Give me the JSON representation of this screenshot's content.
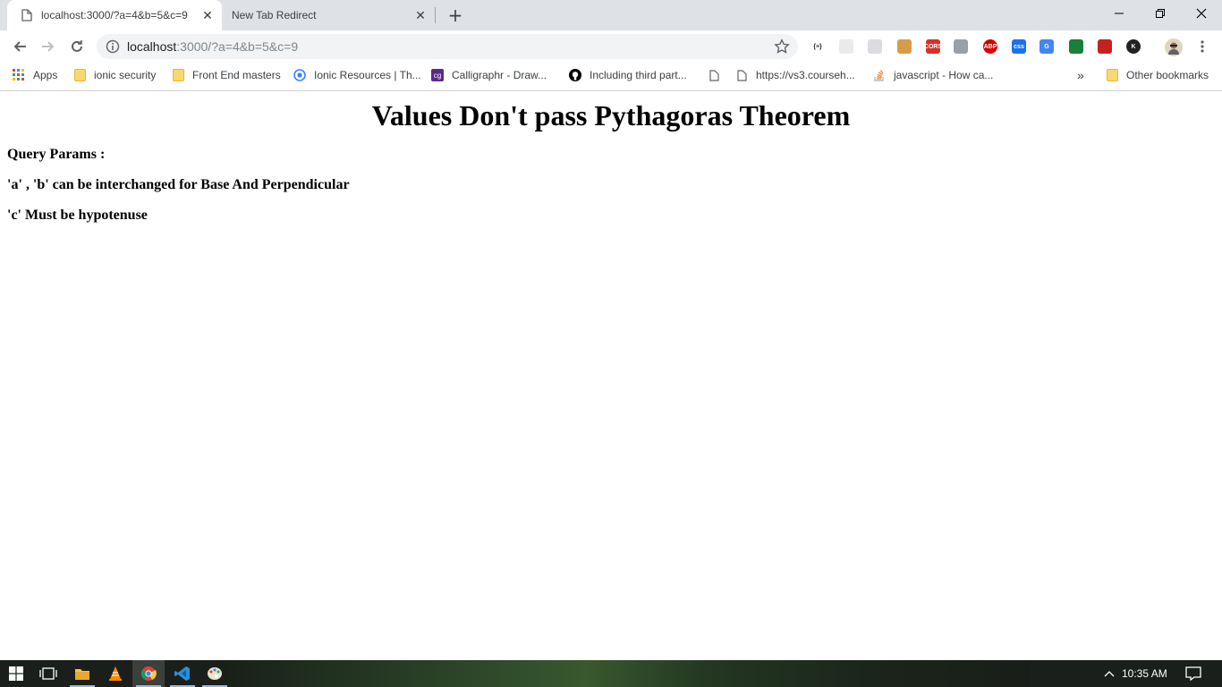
{
  "browser": {
    "tabs": [
      {
        "title": "localhost:3000/?a=4&b=5&c=9",
        "active": true
      },
      {
        "title": "New Tab Redirect",
        "active": false
      }
    ],
    "address": {
      "host": "localhost",
      "rest": ":3000/?a=4&b=5&c=9"
    },
    "bookmarks": [
      {
        "label": "Apps",
        "icon": "apps-grid-icon"
      },
      {
        "label": "ionic security",
        "icon": "folder-icon"
      },
      {
        "label": "Front End masters",
        "icon": "folder-icon"
      },
      {
        "label": "Ionic Resources | Th...",
        "icon": "ionic-icon"
      },
      {
        "label": "Calligraphr - Draw...",
        "icon": "calligraphr-icon"
      },
      {
        "label": "Including third part...",
        "icon": "github-icon"
      },
      {
        "label": "",
        "icon": "page-icon"
      },
      {
        "label": "https://vs3.courseh...",
        "icon": "page-icon"
      },
      {
        "label": "javascript - How ca...",
        "icon": "stackoverflow-icon"
      }
    ],
    "bookmarks_overflow": "»",
    "other_bookmarks": "Other bookmarks"
  },
  "page": {
    "heading": "Values Don't pass Pythagoras Theorem",
    "lines": [
      "Query Params :",
      "'a' , 'b' can be interchanged for Base And Perpendicular",
      "'c' Must be hypotenuse"
    ]
  },
  "extensions": [
    {
      "name": "json-viewer-icon",
      "label": "{≡}",
      "color": "#ffffff"
    },
    {
      "name": "cloud-icon",
      "label": "",
      "color": "#e8eaed"
    },
    {
      "name": "reader-icon",
      "label": "",
      "color": "#dadce0"
    },
    {
      "name": "cookie-icon",
      "label": "",
      "color": "#d79b4a"
    },
    {
      "name": "cors-icon",
      "label": "CORS",
      "color": "#d93025"
    },
    {
      "name": "shield-icon",
      "label": "",
      "color": "#9aa0a6"
    },
    {
      "name": "adblock-icon",
      "label": "ABP",
      "color": "#d50000"
    },
    {
      "name": "css-icon",
      "label": "css",
      "color": "#1a73e8"
    },
    {
      "name": "translate-icon",
      "label": "G",
      "color": "#4285f4"
    },
    {
      "name": "globe-icon",
      "label": "",
      "color": "#188038"
    },
    {
      "name": "tool-icon",
      "label": "",
      "color": "#c5221f"
    },
    {
      "name": "k-icon",
      "label": "K",
      "color": "#202124"
    }
  ],
  "taskbar": {
    "time": "10:35 AM",
    "apps": [
      "windows-start-icon",
      "task-view-icon",
      "file-explorer-icon",
      "vlc-icon",
      "chrome-icon",
      "vscode-icon",
      "paint-icon"
    ]
  }
}
